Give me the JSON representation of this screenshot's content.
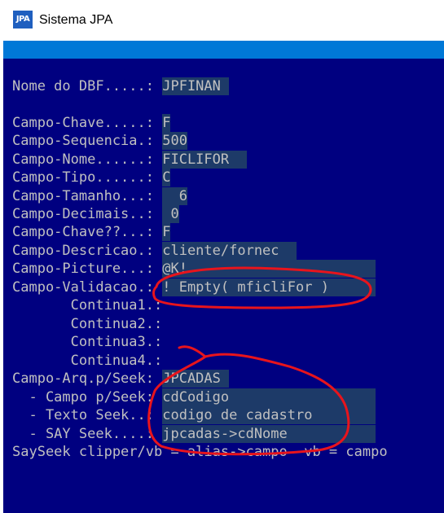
{
  "window": {
    "title": "Sistema JPA",
    "icon": "JPA"
  },
  "rows": [
    {
      "label": "Nome do DBF.....: ",
      "value": "JPFINAN"
    },
    {
      "label": "Campo-Chave.....: ",
      "value": "F"
    },
    {
      "label": "Campo-Sequencia.: ",
      "value": "500"
    },
    {
      "label": "Campo-Nome......: ",
      "value": "FICLIFOR"
    },
    {
      "label": "Campo-Tipo......: ",
      "value": "C"
    },
    {
      "label": "Campo-Tamanho...: ",
      "value": "  6"
    },
    {
      "label": "Campo-Decimais..: ",
      "value": " 0"
    },
    {
      "label": "Campo-Chave??...: ",
      "value": "F"
    },
    {
      "label": "Campo-Descricao.: ",
      "value": "cliente/fornec"
    },
    {
      "label": "Campo-Picture...: ",
      "value": "@K!"
    },
    {
      "label": "Campo-Validacao.: ",
      "value": "! Empty( mficliFor )"
    },
    {
      "label": "       Continua1.: ",
      "value": ""
    },
    {
      "label": "       Continua2.: ",
      "value": ""
    },
    {
      "label": "       Continua3.: ",
      "value": ""
    },
    {
      "label": "       Continua4.: ",
      "value": ""
    },
    {
      "label": "Campo-Arq.p/Seek: ",
      "value": "JPCADAS"
    },
    {
      "label": "  - Campo p/Seek: ",
      "value": "cdCodigo"
    },
    {
      "label": "  - Texto Seek..: ",
      "value": "codigo de cadastro"
    },
    {
      "label": "  - SAY Seek....: ",
      "value": "jpcadas->cdNome"
    }
  ],
  "footer_text": "SaySeek clipper/vb = alias->campo  vb = campo",
  "colors": {
    "console_bg": "#000080",
    "text": "#c0c0c0",
    "field_bg": "#1d3a68",
    "annotation": "#e8141c"
  }
}
